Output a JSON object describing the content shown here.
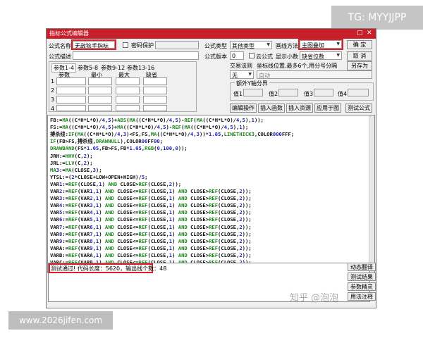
{
  "overlay": {
    "tg_label": "TG: MYYJJPP",
    "site_label": "www.2026jifen.com",
    "watermark": "知乎 @泡泡"
  },
  "window": {
    "title": "指标公式编辑器",
    "min_icon": "□",
    "close_icon": "✕"
  },
  "form": {
    "name_label": "公式名称",
    "name_value": "无敌狯手指标",
    "password_label": "密码保护",
    "desc_label": "公式描述",
    "type_label": "公式类型",
    "type_value": "其他类型",
    "draw_label": "画线方法",
    "draw_value": "主图叠加",
    "version_label": "公式版本",
    "version_value": "0",
    "cloud_label": "云公式",
    "decimals_label": "显示小数",
    "decimals_value": "缺省位数",
    "ok_btn": "确  定",
    "cancel_btn": "取  消",
    "saveas_btn": "另存为"
  },
  "params": {
    "tabs": [
      "参数1-4",
      "参数5-8",
      "参数9-12",
      "参数13-16"
    ],
    "headers": [
      "参数",
      "最小",
      "最大",
      "缺省"
    ],
    "rows": [
      "1",
      "2",
      "3",
      "4"
    ]
  },
  "trade": {
    "rule_label": "交易法则",
    "coord_label": "坐标线位置,最多6个,用分号分隔",
    "rule_value": "无",
    "auto_value": "自动",
    "axis_title": "额外Y轴分界",
    "values": [
      "值1",
      "值2",
      "值3",
      "值4"
    ]
  },
  "actions": {
    "edit": "编辑操作",
    "insert_func": "插入函数",
    "insert_res": "插入资源",
    "apply_chart": "应用于图",
    "test": "测试公式"
  },
  "code_lines": [
    "FB:=MA((C*H*L*O)/4,5)+ABS(MA((C*H*L*O)/4,5)-REF(MA((C*H*L*O)/4,5),1));",
    "FS:=MA((C*H*L*O)/4,5)+MA((C*H*L*O)/4,5)-REF(MA((C*H*L*O)/4,5),1);",
    "搏杀线:IF(MA((C*H*L*O)/4,3)<FS,FS,MA((C*H*L*O)/4,3))*1.05,LINETHICK3,COLOR000FFF;",
    "IF(FB>FS,搏杀线,DRAWNULL),COLOR00FF00;",
    "DRAWBAND(FS*1.05,FB>FS,FB*1.05,RGB(0,100,0));",
    "JRH:=HHV(C,2);",
    "JRL:=LLV(C,2);",
    "MA3:=MA(CLOSE,3);",
    "YTSL:=(2*CLOSE+LOW+OPEN+HIGH)/5;",
    "VAR1:=REF(CLOSE,1) AND CLOSE>REF(CLOSE,2));",
    "VAR2:=REF(VAR1,1) AND CLOSE<=REF(CLOSE,1) AND CLOSE>REF(CLOSE,2));",
    "VAR3:=REF(VAR2,1) AND CLOSE<=REF(CLOSE,1) AND CLOSE>REF(CLOSE,2));",
    "VAR4:=REF(VAR3,1) AND CLOSE<=REF(CLOSE,1) AND CLOSE>REF(CLOSE,2));",
    "VAR5:=REF(VAR4,1) AND CLOSE<=REF(CLOSE,1) AND CLOSE>REF(CLOSE,2));",
    "VAR6:=REF(VAR5,1) AND CLOSE<=REF(CLOSE,1) AND CLOSE>REF(CLOSE,2));",
    "VAR7:=REF(VAR6,1) AND CLOSE<=REF(CLOSE,1) AND CLOSE>REF(CLOSE,2));",
    "VAR8:=REF(VAR7,1) AND CLOSE<=REF(CLOSE,1) AND CLOSE>REF(CLOSE,2));",
    "VAR9:=REF(VAR8,1) AND CLOSE<=REF(CLOSE,1) AND CLOSE>REF(CLOSE,2));",
    "VARA:=REF(VAR9,1) AND CLOSE<=REF(CLOSE,1) AND CLOSE>REF(CLOSE,2));",
    "VARB:=REF(VARA,1) AND CLOSE<=REF(CLOSE,1) AND CLOSE>REF(CLOSE,2));",
    "VARC:=REF(VARB,1) AND CLOSE<=REF(CLOSE,1) AND CLOSE>REF(CLOSE,2));"
  ],
  "status": {
    "message": "测试通过! 代码长度：5620，输出线个数：48"
  },
  "side_buttons": [
    "动态翻译",
    "测试结果",
    "参数精灵",
    "用法注释"
  ],
  "colors": {
    "title_bg": "#c8202b",
    "highlight": "#d8202a",
    "code_black": "#101010",
    "code_green": "#1a8a1a",
    "code_blue": "#2222bb"
  }
}
